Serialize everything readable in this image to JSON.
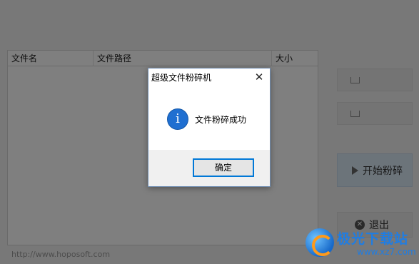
{
  "table": {
    "columns": [
      "文件名",
      "文件路径",
      "大小"
    ]
  },
  "side_buttons": {
    "add_file": "",
    "add_folder": "",
    "start": "开始粉碎",
    "exit": "退出"
  },
  "footer": {
    "url": "http://www.hoposoft.com"
  },
  "watermark": {
    "title": "极光下载站",
    "url": "www.xz7.com"
  },
  "dialog": {
    "title": "超级文件粉碎机",
    "close_glyph": "✕",
    "icon": "info-icon",
    "icon_glyph": "i",
    "message": "文件粉碎成功",
    "ok_label": "确定"
  },
  "colors": {
    "overlay": "rgba(0,0,0,0.5)",
    "accent": "#0078d7",
    "info_icon": "#1f6fd1"
  }
}
